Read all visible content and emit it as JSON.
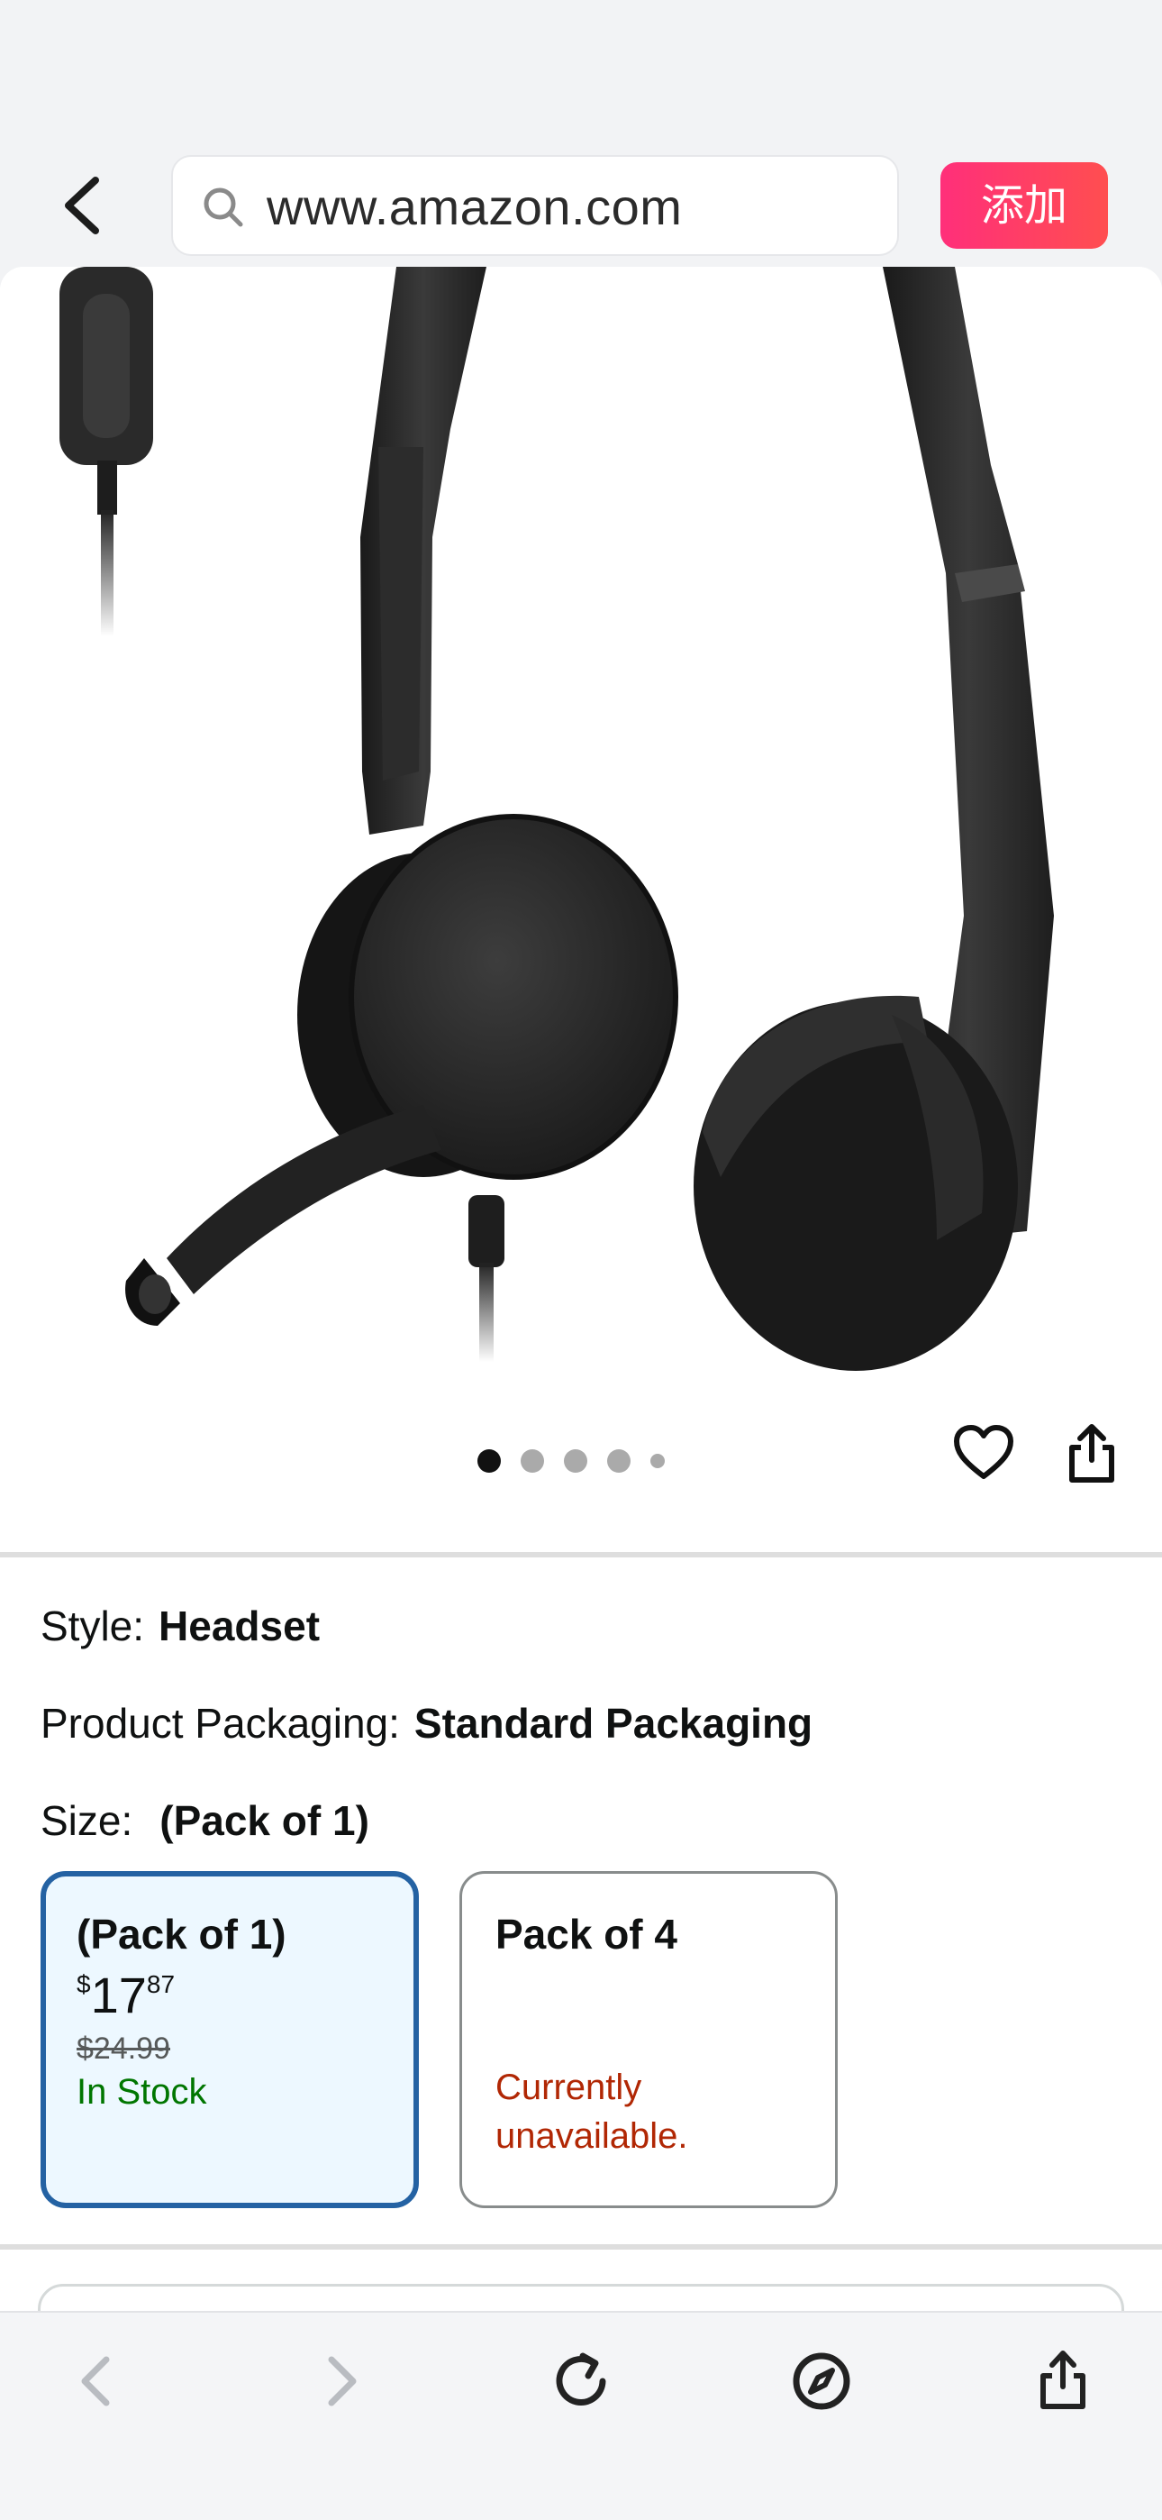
{
  "browser": {
    "url": "www.amazon.com",
    "add_button_label": "添加",
    "accent_color": "#ff2f7a"
  },
  "gallery": {
    "image_description_icon": "headset-product-image",
    "page_count": 5,
    "active_index": 0
  },
  "options": {
    "style_label": "Style:",
    "style_value": "Headset",
    "packaging_label": "Product Packaging:",
    "packaging_value": "Standard Packaging",
    "size_label": "Size:",
    "size_value": "(Pack of 1)"
  },
  "size_cards": [
    {
      "title": "(Pack of 1)",
      "currency": "$",
      "price_whole": "17",
      "price_fraction": "87",
      "list_price": "$24.99",
      "availability": "In Stock",
      "selected": true
    },
    {
      "title": "Pack of 4",
      "availability": "Currently unavailable.",
      "selected": false
    }
  ],
  "colors": {
    "selected_border": "#2462a3",
    "selected_bg": "#edf8ff",
    "in_stock": "#007600",
    "unavailable": "#b12704"
  },
  "toolbar": {
    "icons": [
      "back-icon",
      "forward-icon",
      "reload-icon",
      "compass-icon",
      "share-icon"
    ]
  }
}
